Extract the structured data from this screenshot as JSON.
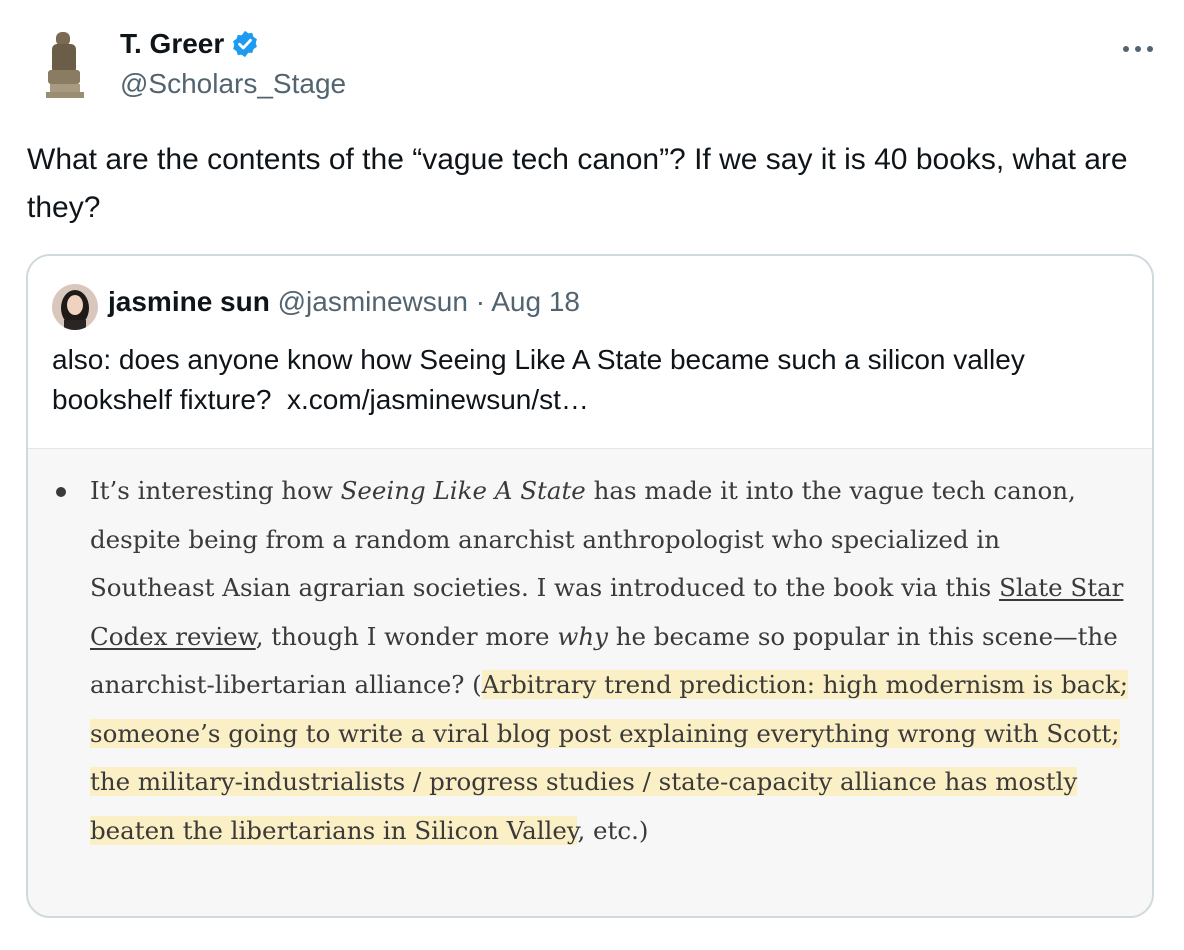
{
  "tweet": {
    "author_name": "T. Greer",
    "author_handle": "@Scholars_Stage",
    "more_icon": "more-dots-icon",
    "text": "What are the contents of the “vague tech canon”? If we say it is 40 books, what are they?"
  },
  "quote": {
    "author_name": "jasmine sun",
    "author_handle": "@jasminewsun",
    "separator": "·",
    "date": "Aug 18",
    "text_main": "also: does anyone know how Seeing Like A State became such a silicon valley bookshelf fixture?",
    "link": "x.com/jasminewsun/st…"
  },
  "screenshot": {
    "p1": "It’s interesting how ",
    "book": "Seeing Like A State",
    "p2": " has made it into the vague tech canon, despite being from a random anarchist anthropologist who specialized in Southeast Asian agrarian societies. I was introduced to the book via this ",
    "link_text": "Slate Star Codex review",
    "p3": ", though I wonder more ",
    "why": "why",
    "p4": " he became so popular in this scene—the anarchist-libertarian alliance? (",
    "highlight": "Arbitrary trend prediction: high modernism is back; someone’s going to write a viral blog post explaining everything wrong with Scott; the military-industrialists / progress studies / state-capacity alliance has mostly beaten the libertarians in Silicon Valley",
    "p5": ", etc.)"
  },
  "colors": {
    "verified": "#1d9bf0",
    "highlight": "#fbefc6",
    "secondary_text": "#536471"
  }
}
